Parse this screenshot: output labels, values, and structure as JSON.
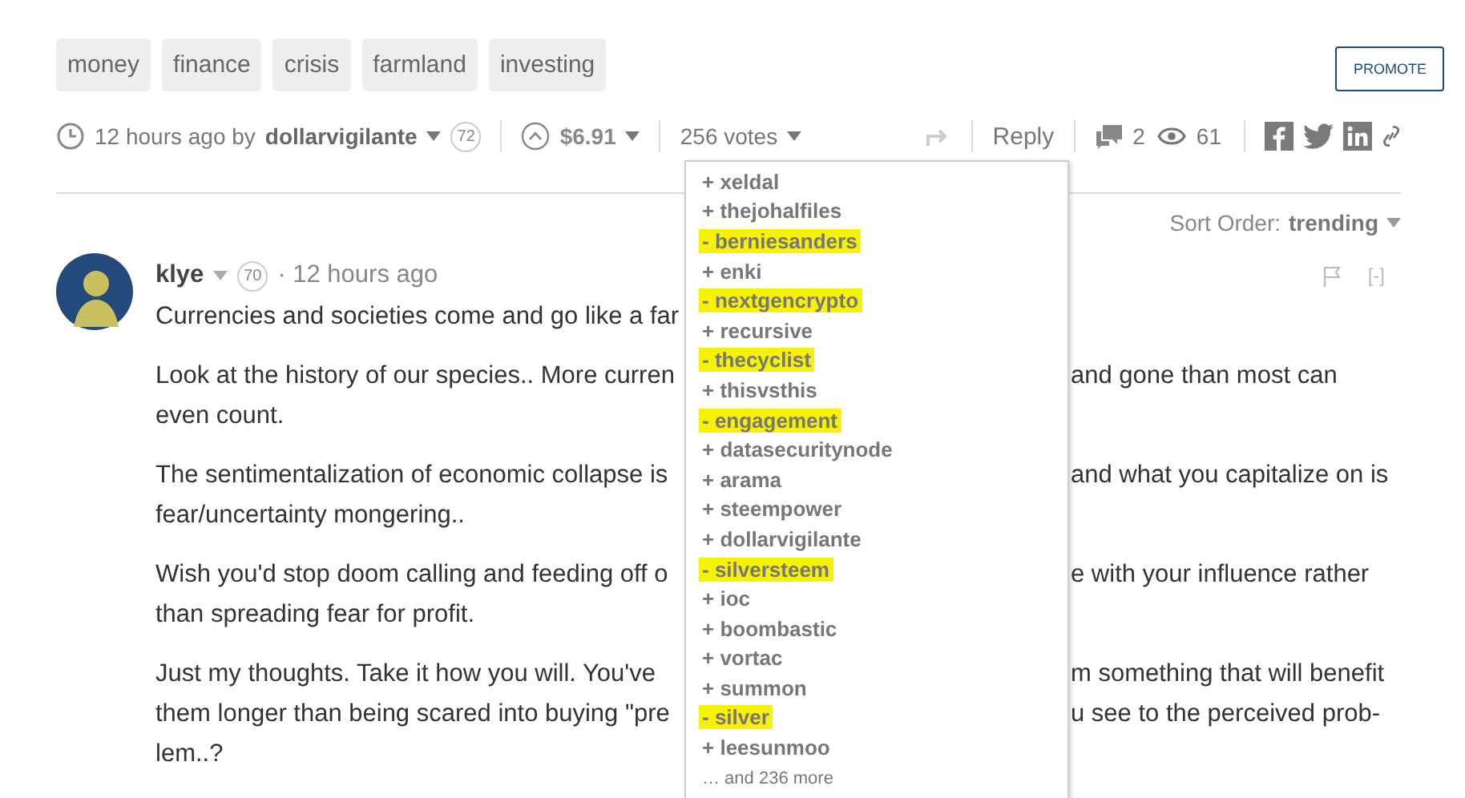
{
  "tags": [
    "money",
    "finance",
    "crisis",
    "farmland",
    "investing"
  ],
  "promote_button": "PROMOTE",
  "post_meta": {
    "time": "12 hours ago by",
    "author": "dollarvigilante",
    "reputation": "72",
    "payout": "$6.91",
    "votes": "256 votes",
    "reply": "Reply",
    "comments": "2",
    "views": "61"
  },
  "votes_dropdown": {
    "items": [
      {
        "text": "+ xeldal",
        "highlighted": false
      },
      {
        "text": "+ thejohalfiles",
        "highlighted": false
      },
      {
        "text": "- berniesanders",
        "highlighted": true
      },
      {
        "text": "+ enki",
        "highlighted": false
      },
      {
        "text": "- nextgencrypto",
        "highlighted": true
      },
      {
        "text": "+ recursive",
        "highlighted": false
      },
      {
        "text": "- thecyclist",
        "highlighted": true
      },
      {
        "text": "+ thisvsthis",
        "highlighted": false
      },
      {
        "text": "- engagement",
        "highlighted": true
      },
      {
        "text": "+ datasecuritynode",
        "highlighted": false
      },
      {
        "text": "+ arama",
        "highlighted": false
      },
      {
        "text": "+ steempower",
        "highlighted": false
      },
      {
        "text": "+ dollarvigilante",
        "highlighted": false
      },
      {
        "text": "- silversteem",
        "highlighted": true
      },
      {
        "text": "+ ioc",
        "highlighted": false
      },
      {
        "text": "+ boombastic",
        "highlighted": false
      },
      {
        "text": "+ vortac",
        "highlighted": false
      },
      {
        "text": "+ summon",
        "highlighted": false
      },
      {
        "text": "- silver",
        "highlighted": true
      },
      {
        "text": "+ leesunmoo",
        "highlighted": false
      }
    ],
    "more": "… and 236 more"
  },
  "sort_order": {
    "label": "Sort Order:",
    "value": "trending"
  },
  "comment": {
    "author": "klye",
    "reputation": "70",
    "time": "· 12 hours ago",
    "collapse": "[-]",
    "paragraphs": [
      {
        "lines": [
          {
            "left": "Currencies and societies come and go like a far"
          }
        ]
      },
      {
        "lines": [
          {
            "left": "Look at the history of our species.. More curren",
            "right": "and gone than most can"
          },
          {
            "left": "even count."
          }
        ]
      },
      {
        "lines": [
          {
            "left": "The sentimentalization of economic collapse is",
            "right": "and what you capitalize on is"
          },
          {
            "left": "fear/uncertainty mongering.."
          }
        ]
      },
      {
        "lines": [
          {
            "left": "Wish you'd stop doom calling and feeding off o",
            "right": "e with your influence rather"
          },
          {
            "left": "than spreading fear for profit."
          }
        ]
      },
      {
        "lines": [
          {
            "left": "Just my thoughts. Take it how you will. You've",
            "right": "m something that will benefit"
          },
          {
            "left": "them longer than being scared into buying \"pre",
            "right": "u see to the perceived prob-"
          },
          {
            "left": "lem..?"
          }
        ]
      }
    ]
  }
}
